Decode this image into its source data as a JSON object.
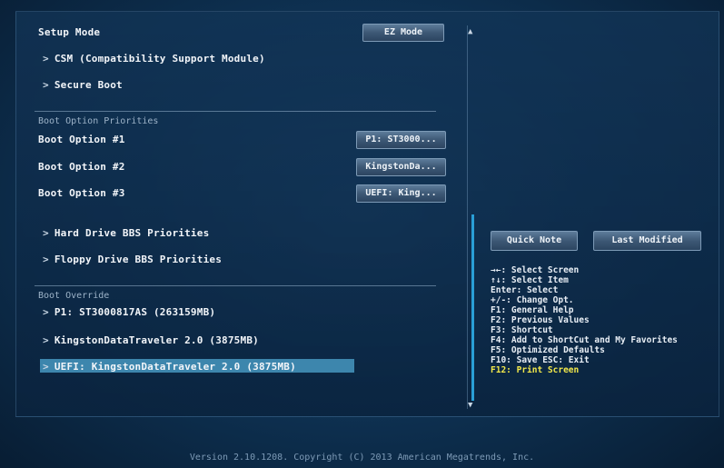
{
  "setup_mode": {
    "label": "Setup Mode",
    "button": "EZ Mode"
  },
  "menu": {
    "csm": "CSM (Compatibility Support Module)",
    "secure_boot": "Secure Boot"
  },
  "boot_priorities": {
    "heading": "Boot Option Priorities",
    "options": [
      {
        "label": "Boot Option #1",
        "value": "P1: ST3000..."
      },
      {
        "label": "Boot Option #2",
        "value": "KingstonDa..."
      },
      {
        "label": "Boot Option #3",
        "value": "UEFI: King..."
      }
    ],
    "hdd_bbs": "Hard Drive BBS Priorities",
    "floppy_bbs": "Floppy Drive BBS Priorities"
  },
  "boot_override": {
    "heading": "Boot Override",
    "items": [
      "P1: ST3000817AS (263159MB)",
      "KingstonDataTraveler 2.0 (3875MB)",
      "UEFI: KingstonDataTraveler 2.0 (3875MB)"
    ]
  },
  "right_buttons": {
    "quick_note": "Quick Note",
    "last_modified": "Last Modified"
  },
  "help": [
    "→←: Select Screen",
    "↑↓: Select Item",
    "Enter: Select",
    "+/-: Change Opt.",
    "F1: General Help",
    "F2: Previous Values",
    "F3: Shortcut",
    "F4: Add to ShortCut and My Favorites",
    "F5: Optimized Defaults",
    "F10: Save  ESC: Exit",
    "F12: Print Screen"
  ],
  "footer": "Version 2.10.1208. Copyright (C) 2013 American Megatrends, Inc.",
  "colors": {
    "accent": "#2a9fd6",
    "highlight": "#3d86ad",
    "key_highlight": "#f2e84a"
  }
}
